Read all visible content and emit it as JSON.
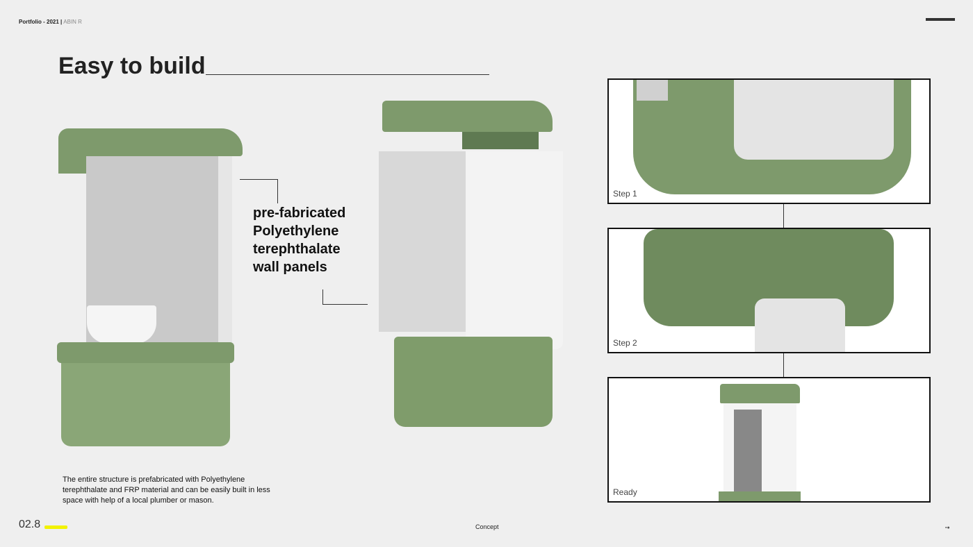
{
  "header": {
    "portfolio": "Portfolio - 2021",
    "separator": "|",
    "author": "ABIN R"
  },
  "title": "Easy to build",
  "caption": {
    "lines": [
      "pre-fabricated",
      "Polyethylene",
      "terephthalate",
      "wall panels"
    ]
  },
  "description": "The entire structure is prefabricated with Polyethylene terephthalate and FRP material and can be easily built in less space with help of a local plumber or mason.",
  "steps": [
    {
      "label": "Step 1"
    },
    {
      "label": "Step 2"
    },
    {
      "label": "Ready"
    }
  ],
  "footer": {
    "page_number": "02.8",
    "section": "Concept",
    "nav_icon": "▪●"
  },
  "colors": {
    "accent": "#f2f200",
    "green": "#7e9a6c"
  }
}
